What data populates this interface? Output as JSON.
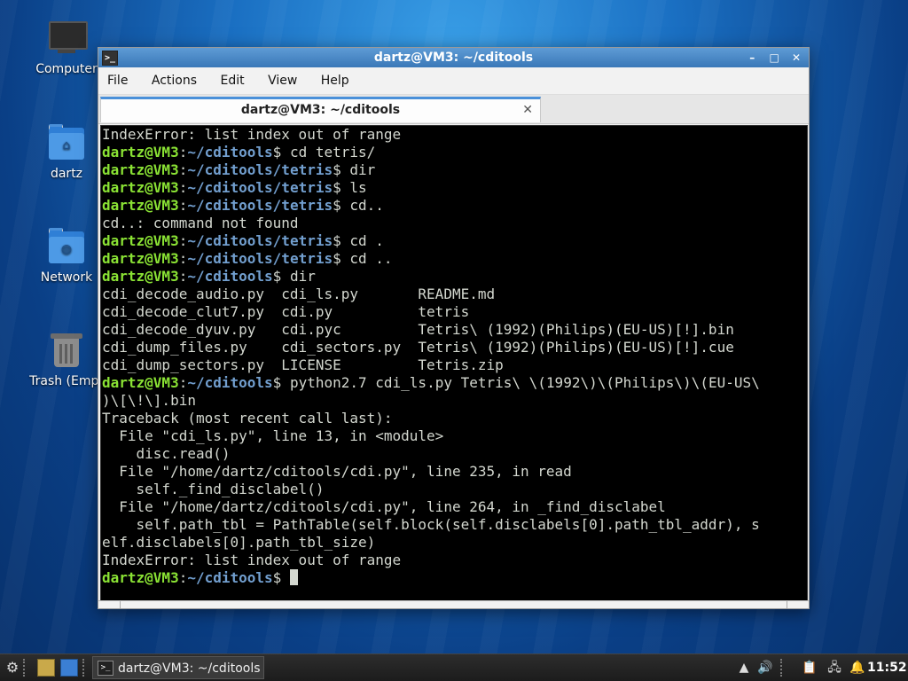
{
  "desktop": {
    "icons": [
      {
        "label": "Computer",
        "icon": "computer-icon"
      },
      {
        "label": "dartz",
        "icon": "home-folder-icon"
      },
      {
        "label": "Network",
        "icon": "network-folder-icon"
      },
      {
        "label": "Trash (Empt",
        "icon": "trash-icon"
      }
    ]
  },
  "window": {
    "title": "dartz@VM3: ~/cditools",
    "app_icon_text": ">_",
    "controls": {
      "minimize": "–",
      "maximize": "□",
      "close": "✕"
    },
    "menu": [
      "File",
      "Actions",
      "Edit",
      "View",
      "Help"
    ],
    "tab": {
      "label": "dartz@VM3: ~/cditools",
      "close": "✕"
    }
  },
  "terminal": {
    "colors": {
      "user": "#8ae234",
      "path": "#729fcf",
      "text": "#d3d7cf",
      "bg": "#000000"
    },
    "lines": [
      {
        "type": "text",
        "text": "IndexError: list index out of range"
      },
      {
        "type": "prompt",
        "user": "dartz@VM3",
        "sep": ":",
        "path": "~/cditools",
        "cmd": "$ cd tetris/"
      },
      {
        "type": "prompt",
        "user": "dartz@VM3",
        "sep": ":",
        "path": "~/cditools/tetris",
        "cmd": "$ dir"
      },
      {
        "type": "prompt",
        "user": "dartz@VM3",
        "sep": ":",
        "path": "~/cditools/tetris",
        "cmd": "$ ls"
      },
      {
        "type": "prompt",
        "user": "dartz@VM3",
        "sep": ":",
        "path": "~/cditools/tetris",
        "cmd": "$ cd.."
      },
      {
        "type": "text",
        "text": "cd..: command not found"
      },
      {
        "type": "prompt",
        "user": "dartz@VM3",
        "sep": ":",
        "path": "~/cditools/tetris",
        "cmd": "$ cd ."
      },
      {
        "type": "prompt",
        "user": "dartz@VM3",
        "sep": ":",
        "path": "~/cditools/tetris",
        "cmd": "$ cd .."
      },
      {
        "type": "prompt",
        "user": "dartz@VM3",
        "sep": ":",
        "path": "~/cditools",
        "cmd": "$ dir"
      },
      {
        "type": "text",
        "text": "cdi_decode_audio.py  cdi_ls.py       README.md"
      },
      {
        "type": "text",
        "text": "cdi_decode_clut7.py  cdi.py          tetris"
      },
      {
        "type": "text",
        "text": "cdi_decode_dyuv.py   cdi.pyc         Tetris\\ (1992)(Philips)(EU-US)[!].bin"
      },
      {
        "type": "text",
        "text": "cdi_dump_files.py    cdi_sectors.py  Tetris\\ (1992)(Philips)(EU-US)[!].cue"
      },
      {
        "type": "text",
        "text": "cdi_dump_sectors.py  LICENSE         Tetris.zip"
      },
      {
        "type": "prompt",
        "user": "dartz@VM3",
        "sep": ":",
        "path": "~/cditools",
        "cmd": "$ python2.7 cdi_ls.py Tetris\\ \\(1992\\)\\(Philips\\)\\(EU-US\\"
      },
      {
        "type": "text",
        "text": ")\\[\\!\\].bin"
      },
      {
        "type": "text",
        "text": "Traceback (most recent call last):"
      },
      {
        "type": "text",
        "text": "  File \"cdi_ls.py\", line 13, in <module>"
      },
      {
        "type": "text",
        "text": "    disc.read()"
      },
      {
        "type": "text",
        "text": "  File \"/home/dartz/cditools/cdi.py\", line 235, in read"
      },
      {
        "type": "text",
        "text": "    self._find_disclabel()"
      },
      {
        "type": "text",
        "text": "  File \"/home/dartz/cditools/cdi.py\", line 264, in _find_disclabel"
      },
      {
        "type": "text",
        "text": "    self.path_tbl = PathTable(self.block(self.disclabels[0].path_tbl_addr), s"
      },
      {
        "type": "text",
        "text": "elf.disclabels[0].path_tbl_size)"
      },
      {
        "type": "text",
        "text": "IndexError: list index out of range"
      },
      {
        "type": "prompt",
        "user": "dartz@VM3",
        "sep": ":",
        "path": "~/cditools",
        "cmd": "$ ",
        "cursor": true
      }
    ]
  },
  "taskbar": {
    "task_label": "dartz@VM3: ~/cditools",
    "task_icon_text": ">_",
    "clock": "11:52"
  }
}
